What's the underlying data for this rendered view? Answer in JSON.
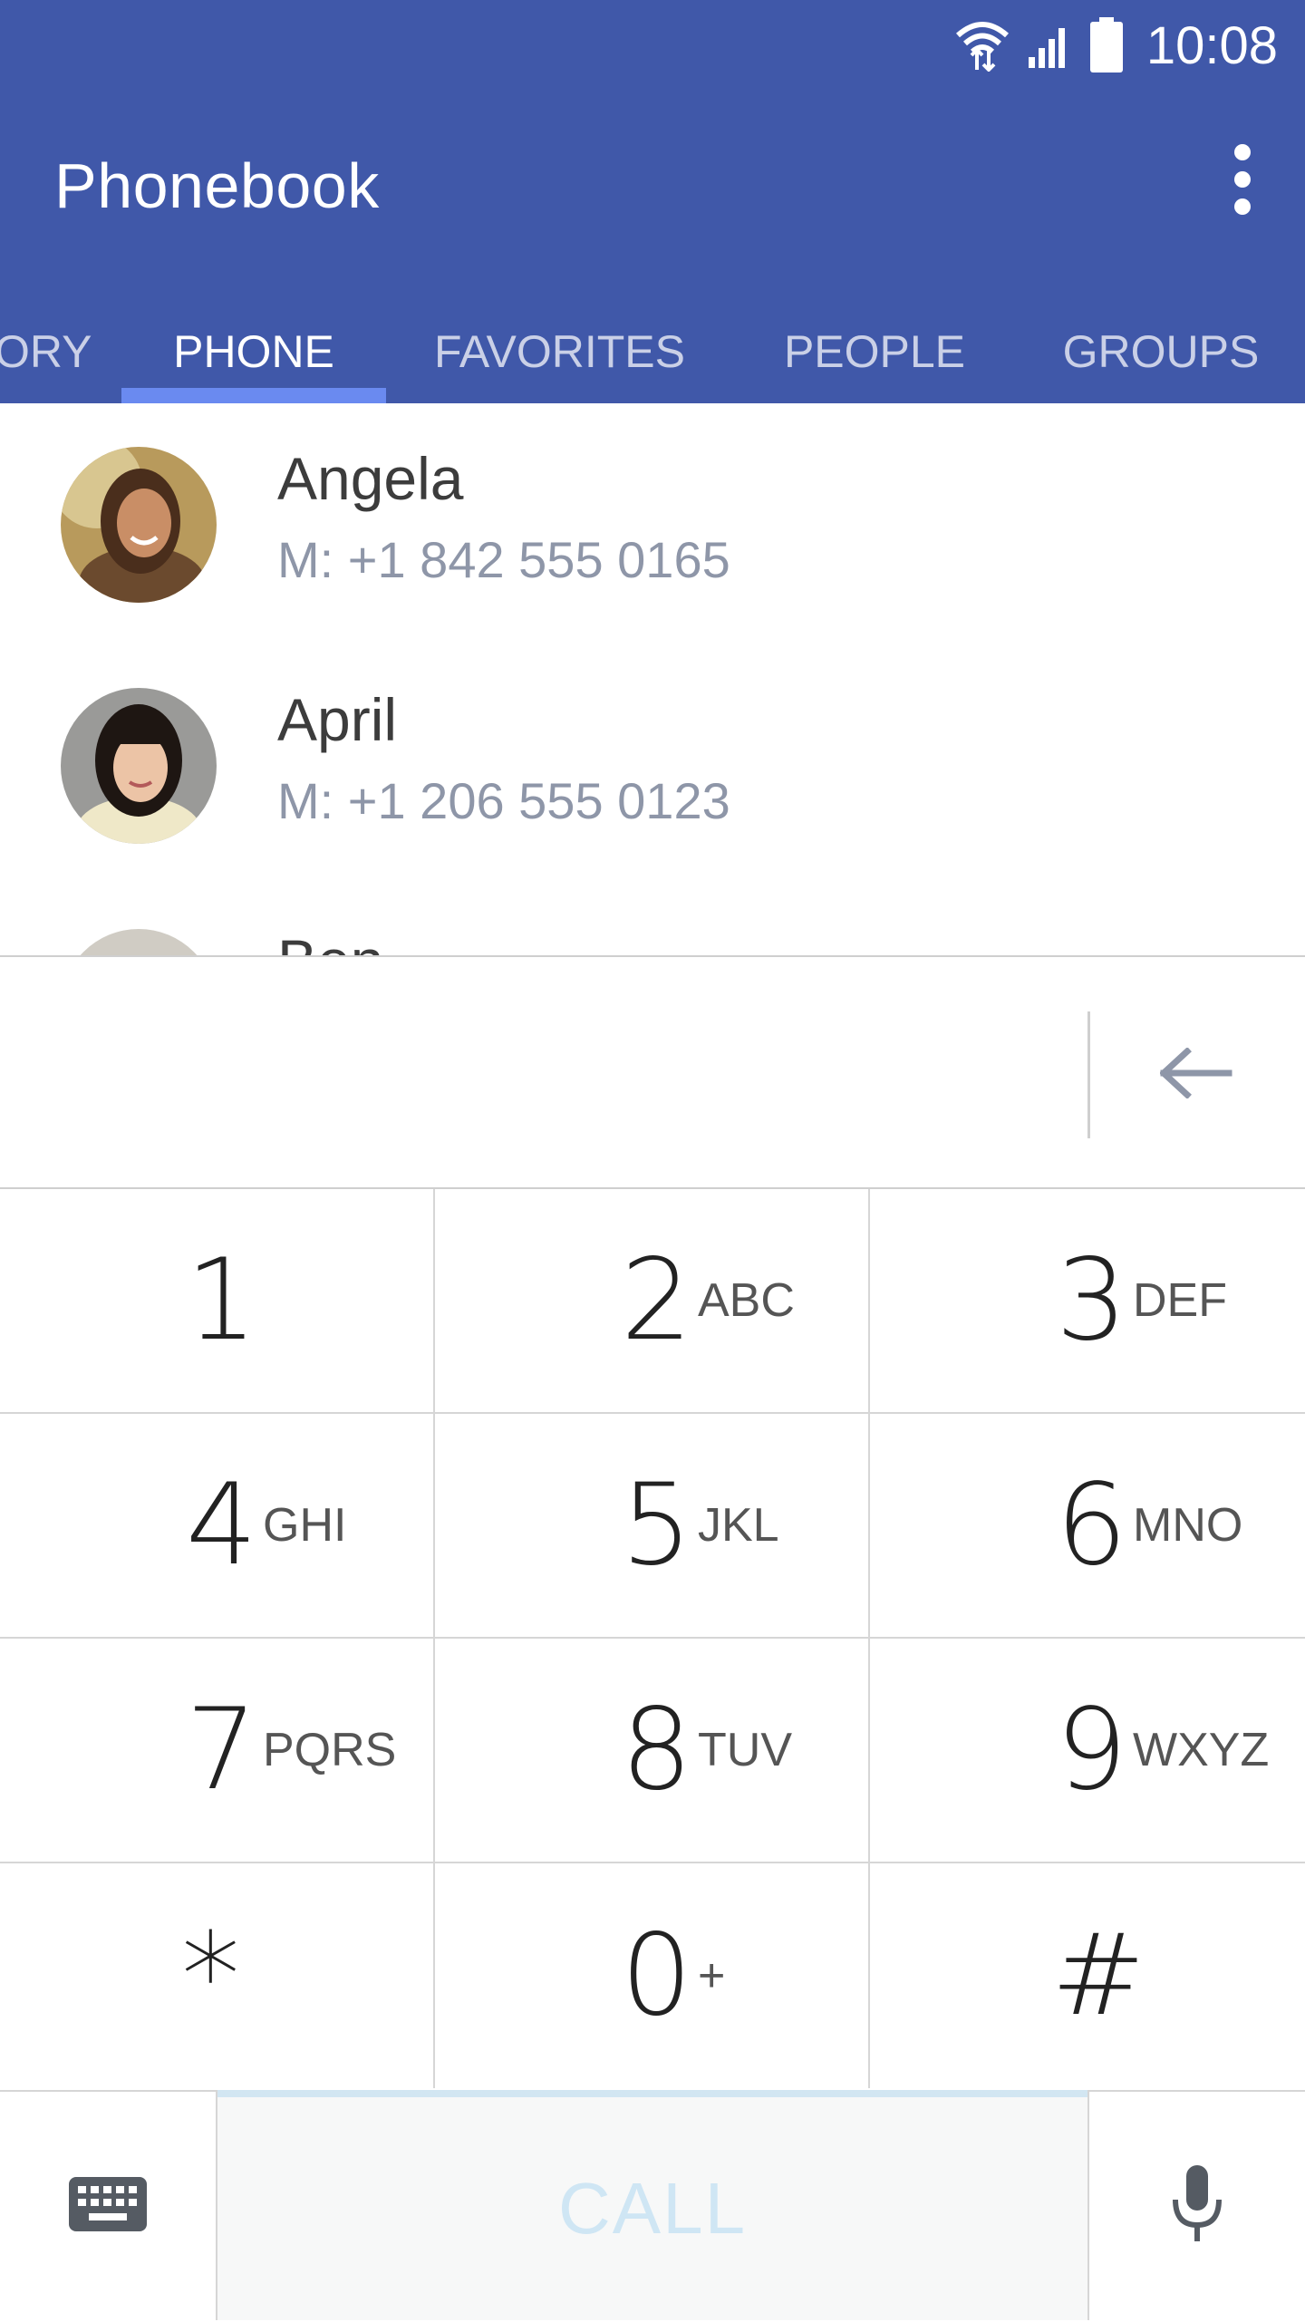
{
  "status_bar": {
    "time": "10:08",
    "icons": [
      "wifi-icon",
      "cell-signal-icon",
      "battery-icon"
    ]
  },
  "app_bar": {
    "title": "Phonebook",
    "menu_icon": "overflow-menu-icon"
  },
  "tabs": [
    {
      "label": "ORY",
      "active": false
    },
    {
      "label": "PHONE",
      "active": true
    },
    {
      "label": "FAVORITES",
      "active": false
    },
    {
      "label": "PEOPLE",
      "active": false
    },
    {
      "label": "GROUPS",
      "active": false
    }
  ],
  "contacts": [
    {
      "name": "Angela",
      "number": "M: +1 842 555 0165"
    },
    {
      "name": "April",
      "number": "M: +1 206 555 0123"
    },
    {
      "name": "Ben",
      "number": ""
    }
  ],
  "dialer": {
    "display_value": "",
    "backspace_icon": "backspace-arrow-icon",
    "keys": [
      {
        "digit": "1",
        "letters": ""
      },
      {
        "digit": "2",
        "letters": "ABC"
      },
      {
        "digit": "3",
        "letters": "DEF"
      },
      {
        "digit": "4",
        "letters": "GHI"
      },
      {
        "digit": "5",
        "letters": "JKL"
      },
      {
        "digit": "6",
        "letters": "MNO"
      },
      {
        "digit": "7",
        "letters": "PQRS"
      },
      {
        "digit": "8",
        "letters": "TUV"
      },
      {
        "digit": "9",
        "letters": "WXYZ"
      },
      {
        "digit": "*",
        "letters": ""
      },
      {
        "digit": "0",
        "letters": "+"
      },
      {
        "digit": "#",
        "letters": ""
      }
    ],
    "call_label": "CALL",
    "keyboard_icon": "keyboard-icon",
    "mic_icon": "microphone-icon"
  },
  "colors": {
    "app_bar": "#4058a9",
    "tab_indicator": "#6a8af0",
    "call_text": "#cfe6f4"
  }
}
